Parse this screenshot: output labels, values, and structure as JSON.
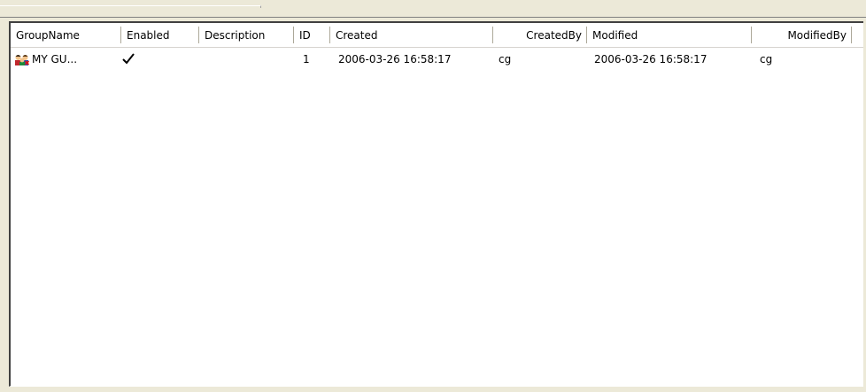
{
  "listview": {
    "columns": [
      {
        "key": "groupname",
        "label": "GroupName"
      },
      {
        "key": "enabled",
        "label": "Enabled"
      },
      {
        "key": "description",
        "label": "Description"
      },
      {
        "key": "id",
        "label": "ID"
      },
      {
        "key": "created",
        "label": "Created"
      },
      {
        "key": "createdby",
        "label": "CreatedBy"
      },
      {
        "key": "modified",
        "label": "Modified"
      },
      {
        "key": "modifiedby",
        "label": "ModifiedBy"
      }
    ],
    "rows": [
      {
        "groupname": "MY GU...",
        "enabled": true,
        "description": "",
        "id": "1",
        "created": "2006-03-26 16:58:17",
        "createdby": "cg",
        "modified": "2006-03-26 16:58:17",
        "modifiedby": "cg",
        "icon": "user-group-icon",
        "enabled_icon": "check-icon"
      }
    ]
  },
  "colors": {
    "window_bg": "#ece9d8",
    "list_bg": "#ffffff",
    "header_separator": "#aca899"
  }
}
